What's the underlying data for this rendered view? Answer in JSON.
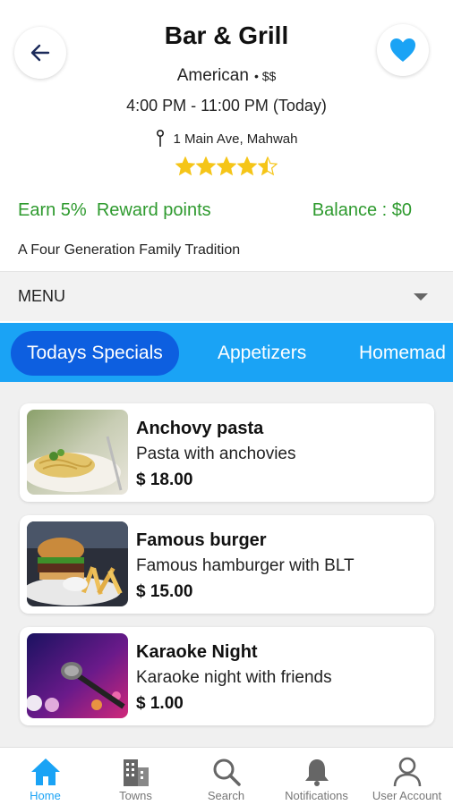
{
  "header": {
    "title": "Bar & Grill",
    "cuisine": "American",
    "price_level": "• $$",
    "hours": "4:00 PM - 11:00 PM (Today)",
    "address": "1 Main Ave, Mahwah",
    "rating": 4.5,
    "rating_max": 5,
    "favorite": true,
    "colors": {
      "star": "#f5c518",
      "heart": "#1aa3f5"
    }
  },
  "rewards": {
    "earn_text": "Earn 5%  Reward points",
    "balance_text": "Balance : $0",
    "color": "#2e9a2e"
  },
  "tagline": "A Four Generation Family Tradition",
  "menu_select": {
    "value": "MENU"
  },
  "tabs": [
    {
      "label": "Todays Specials",
      "active": true
    },
    {
      "label": "Appetizers",
      "active": false
    },
    {
      "label": "Homemad",
      "active": false
    }
  ],
  "items": [
    {
      "name": "Anchovy pasta",
      "description": "Pasta with anchovies",
      "price": "$ 18.00",
      "image": "pasta-photo"
    },
    {
      "name": "Famous burger",
      "description": "Famous hamburger with BLT",
      "price": "$ 15.00",
      "image": "burger-photo"
    },
    {
      "name": "Karaoke Night",
      "description": "Karaoke night with friends",
      "price": "$ 1.00",
      "image": "microphone-photo"
    }
  ],
  "bottom_nav": [
    {
      "label": "Home",
      "icon": "home-icon",
      "active": true
    },
    {
      "label": "Towns",
      "icon": "buildings-icon",
      "active": false
    },
    {
      "label": "Search",
      "icon": "search-icon",
      "active": false
    },
    {
      "label": "Notifications",
      "icon": "bell-icon",
      "active": false
    },
    {
      "label": "User Account",
      "icon": "user-icon",
      "active": false
    }
  ],
  "theme": {
    "accent": "#1aa3f5",
    "active_tab": "#0d5fe0"
  }
}
